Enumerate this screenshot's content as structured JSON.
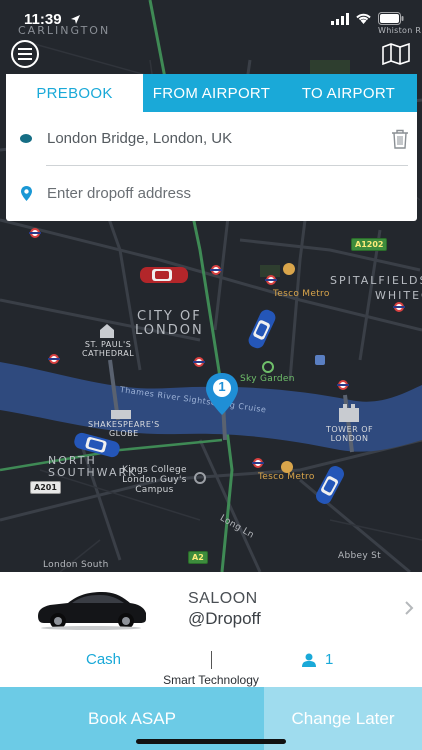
{
  "status_bar": {
    "time": "11:39"
  },
  "booking": {
    "tabs": [
      {
        "label": "PREBOOK",
        "active": true
      },
      {
        "label": "FROM AIRPORT",
        "active": false
      },
      {
        "label": "TO AIRPORT",
        "active": false
      }
    ],
    "pickup_value": "London Bridge, London, UK",
    "dropoff_placeholder": "Enter dropoff address"
  },
  "map": {
    "labels": {
      "city": "CITY OF\nLONDON",
      "st_pauls": "ST. PAUL'S\nCATHEDRAL",
      "globe": "SHAKESPEARE'S\nGLOBE",
      "north_southwark": "NORTH\nSOUTHWARK",
      "tower": "TOWER OF\nLONDON",
      "spitalfields": "SPITALFIELDS",
      "whitechapel": "WHITEC",
      "tesco1": "Tesco Metro",
      "tesco2": "Tesco Metro",
      "sky_garden": "Sky Garden",
      "river": "Thames River Sightseeing Cruise",
      "kings": "Kings College\nLondon Guy's\nCampus",
      "long_ln": "Long Ln",
      "abbey": "Abbey St",
      "london_south": "London South",
      "carlington": "CARLINGTON",
      "whiston": "Whiston R"
    },
    "shields": {
      "a1202": "A1202",
      "a201": "A201",
      "a2": "A2"
    },
    "marker_number": "1"
  },
  "vehicle": {
    "type": "SALOON",
    "price": "@Dropoff"
  },
  "payment": "Cash",
  "passengers": "1",
  "tagline": "Smart Technology",
  "actions": {
    "book_asap": "Book ASAP",
    "change_later": "Change Later"
  },
  "colors": {
    "accent": "#1aa9d8",
    "asap": "#6ccbe6",
    "later": "#9fdcee"
  }
}
